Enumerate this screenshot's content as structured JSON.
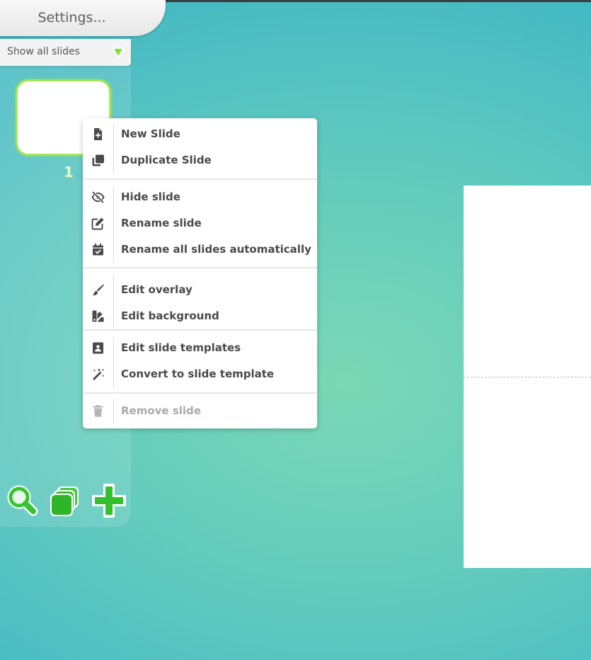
{
  "sidebar": {
    "settings_label": "Settings...",
    "filter": {
      "selected": "Show all slides"
    },
    "slides": [
      {
        "number": "1"
      }
    ]
  },
  "context_menu": {
    "groups": [
      {
        "items": [
          {
            "label": "New Slide",
            "icon": "file-plus-icon"
          },
          {
            "label": "Duplicate Slide",
            "icon": "duplicate-icon"
          }
        ]
      },
      {
        "items": [
          {
            "label": "Hide slide",
            "icon": "eye-slash-icon"
          },
          {
            "label": "Rename slide",
            "icon": "edit-icon"
          },
          {
            "label": "Rename all slides automatically",
            "icon": "calendar-check-icon"
          }
        ]
      },
      {
        "items": [
          {
            "label": "Edit overlay",
            "icon": "paintbrush-icon"
          },
          {
            "label": "Edit background",
            "icon": "swatches-icon"
          }
        ]
      },
      {
        "items": [
          {
            "label": "Edit slide templates",
            "icon": "template-icon"
          },
          {
            "label": "Convert to slide template",
            "icon": "magic-wand-icon"
          }
        ]
      },
      {
        "items": [
          {
            "label": "Remove slide",
            "icon": "trash-icon",
            "disabled": true
          }
        ]
      }
    ]
  },
  "colors": {
    "accent_green": "#6fd83a",
    "menu_text": "#4a4a4a",
    "disabled_text": "#a9a9a9"
  }
}
